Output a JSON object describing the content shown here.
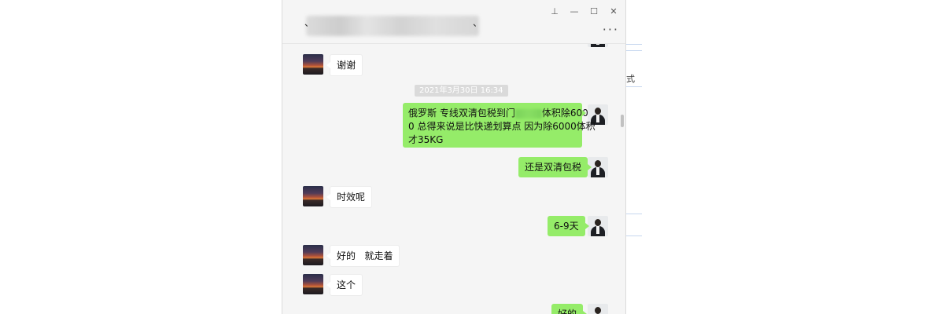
{
  "window": {
    "title_mark": "、",
    "controls": {
      "pin": "⊥",
      "minimize": "—",
      "maximize": "☐",
      "close": "✕"
    },
    "more_label": "···"
  },
  "messages": {
    "m1": {
      "from": "other",
      "text": "谢谢"
    },
    "timestamp": "2021年3月30日 16:34",
    "m2": {
      "from": "me",
      "line1_a": "俄罗斯 专线双清包税到门",
      "line1_b": "体积除600",
      "line2": "0 总得来说是比快递划算点 因为除6000体积",
      "line3": "才35KG"
    },
    "m3": {
      "from": "me",
      "text": "还是双清包税"
    },
    "m4": {
      "from": "other",
      "text": "时效呢"
    },
    "m5": {
      "from": "me",
      "text": "6-9天"
    },
    "m6": {
      "from": "other",
      "text": "好的   就走着"
    },
    "m7": {
      "from": "other",
      "text": "这个"
    },
    "m8": {
      "from": "me",
      "text": "好的"
    }
  },
  "background_app": {
    "char": "式"
  },
  "colors": {
    "outgoing_bubble": "#95ec69",
    "incoming_bubble": "#ffffff",
    "window_bg": "#f5f5f5"
  },
  "icons": [
    "pin-icon",
    "minimize-icon",
    "maximize-icon",
    "close-icon",
    "more-icon"
  ]
}
